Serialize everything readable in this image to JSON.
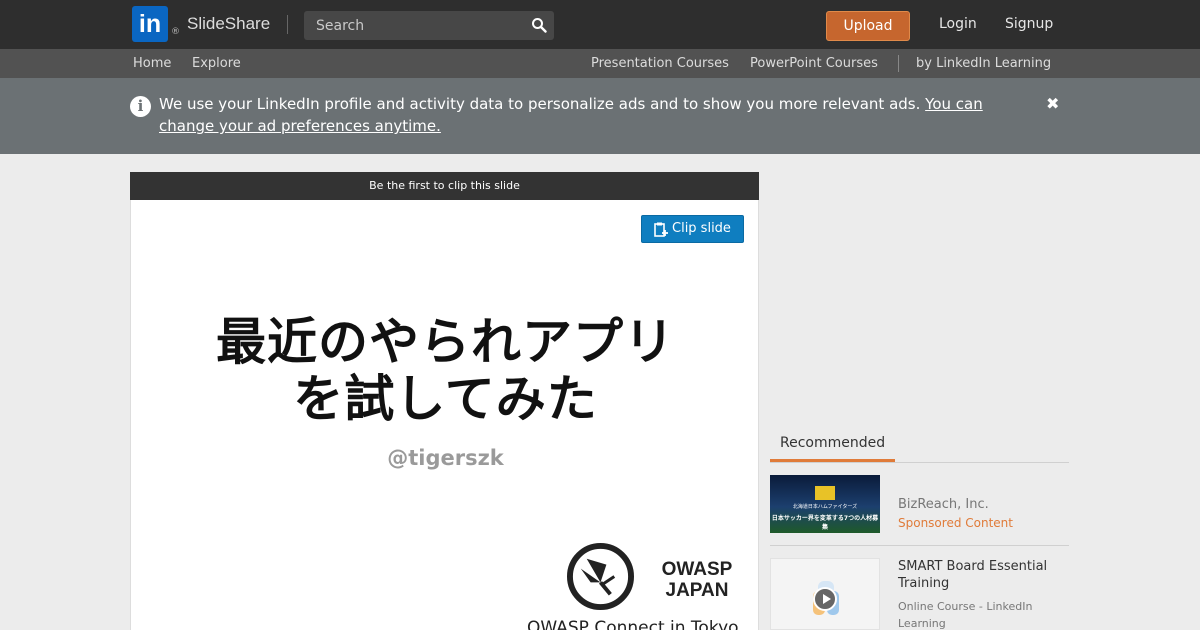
{
  "header": {
    "logo_text": "in",
    "registered_mark": "®",
    "brand": "SlideShare",
    "search_placeholder": "Search",
    "upload_label": "Upload",
    "login_label": "Login",
    "signup_label": "Signup"
  },
  "subnav": {
    "home": "Home",
    "explore": "Explore",
    "presentation_courses": "Presentation Courses",
    "powerpoint_courses": "PowerPoint Courses",
    "linkedin_learning": "by LinkedIn Learning"
  },
  "notice": {
    "text": "We use your LinkedIn profile and activity data to personalize ads and to show you more relevant ads.",
    "link_text": "You can change your ad preferences anytime.",
    "close_glyph": "✖"
  },
  "slide": {
    "clip_banner": "Be the first to clip this slide",
    "clip_button": "Clip slide",
    "title_line1": "最近のやられアプリ",
    "title_line2": "を試してみた",
    "author": "@tigerszk",
    "org_line1": "OWASP",
    "org_line2": "JAPAN",
    "event": "OWASP Connect in Tokyo"
  },
  "recommended": {
    "tab_label": "Recommended",
    "items": [
      {
        "thumb_line1": "北海道日本ハムファイターズ",
        "thumb_line2": "日本サッカー界を変革する7つの人材募集",
        "company": "BizReach, Inc.",
        "tag": "Sponsored Content"
      },
      {
        "title": "SMART Board Essential Training",
        "subtitle": "Online Course - LinkedIn Learning"
      }
    ]
  },
  "colors": {
    "topbar": "#2e2e2e",
    "subnav": "#525252",
    "notice": "#6b7174",
    "upload": "#c6662e",
    "accent": "#e07b39",
    "clip_button": "#0f7ec0",
    "linkedin_blue": "#0a66c2"
  },
  "icons": {
    "search": "search-icon",
    "info": "info-icon",
    "close": "close-icon",
    "clip": "clip-icon",
    "play": "play-icon"
  }
}
